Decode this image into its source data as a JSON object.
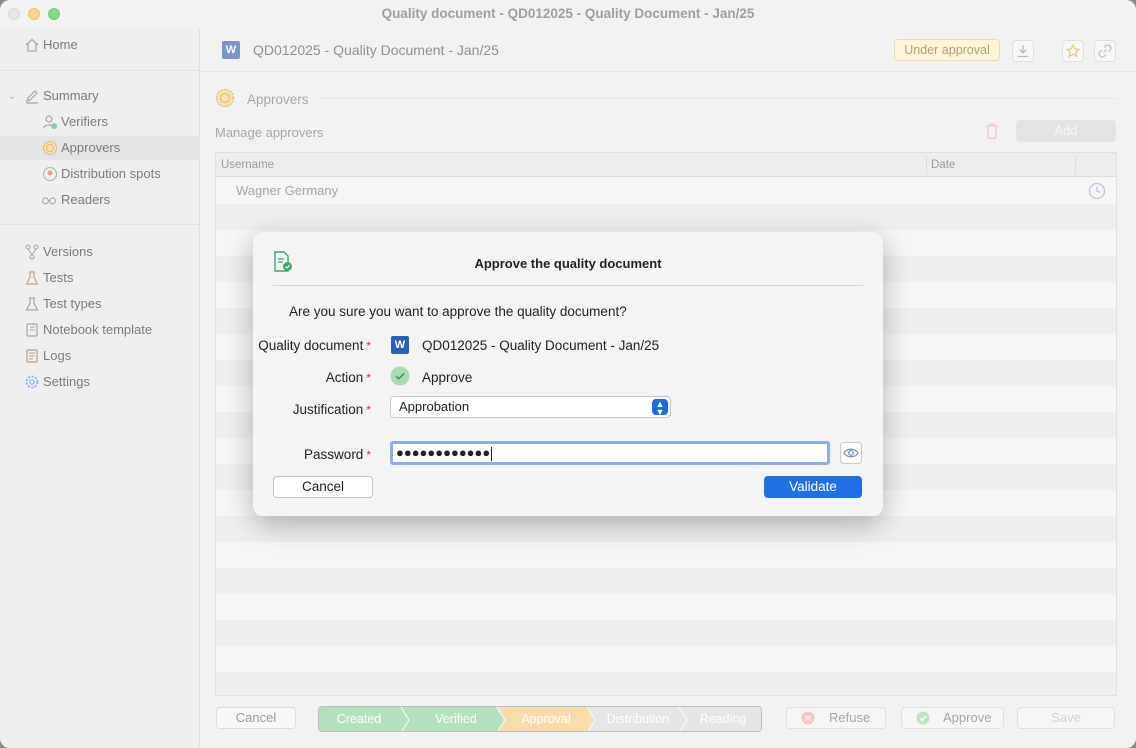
{
  "window": {
    "title": "Quality document - QD012025 - Quality Document - Jan/25"
  },
  "sidebar": {
    "home": "Home",
    "summary": "Summary",
    "verifiers": "Verifiers",
    "approvers": "Approvers",
    "distribution_spots": "Distribution spots",
    "readers": "Readers",
    "versions": "Versions",
    "tests": "Tests",
    "test_types": "Test types",
    "notebook_template": "Notebook template",
    "logs": "Logs",
    "settings": "Settings"
  },
  "header": {
    "title": "QD012025 - Quality Document - Jan/25",
    "status_badge": "Under approval",
    "doc_icon_letter": "W"
  },
  "section": {
    "title": "Approvers",
    "manage_label": "Manage approvers",
    "add_label": "Add"
  },
  "table": {
    "columns": [
      "Username",
      "Date"
    ],
    "rows": [
      {
        "username": "Wagner Germany",
        "date": ""
      }
    ]
  },
  "footer": {
    "cancel": "Cancel",
    "steps": [
      "Created",
      "Verified",
      "Approval",
      "Distribution",
      "Reading"
    ],
    "refuse": "Refuse",
    "approve": "Approve",
    "save": "Save"
  },
  "dialog": {
    "title": "Approve the quality document",
    "question": "Are you sure you want to approve the quality document?",
    "quality_document_label": "Quality document",
    "quality_document_value": "QD012025 - Quality Document - Jan/25",
    "action_label": "Action",
    "action_value": "Approve",
    "justification_label": "Justification",
    "justification_value": "Approbation",
    "password_label": "Password",
    "password_value": "●●●●●●●●●●●●",
    "required_mark": "*",
    "cancel": "Cancel",
    "validate": "Validate"
  },
  "colors": {
    "accent": "#1f6fe5",
    "step_done": "#8fcf9a",
    "step_current": "#f2c97a",
    "badge_bg": "#fbf0c8",
    "required": "#d0312d"
  }
}
